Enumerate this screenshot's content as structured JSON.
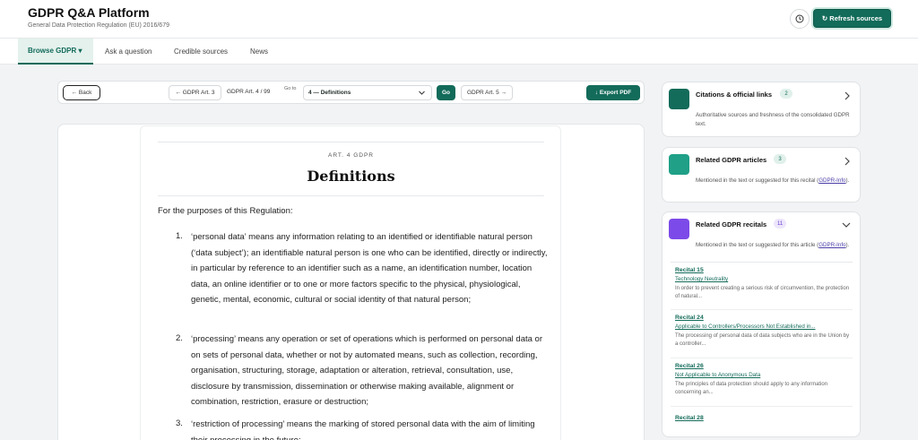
{
  "app": {
    "title": "GDPR Q&A Platform",
    "subtitle": "General Data Protection Regulation (EU) 2016/679",
    "refresh_label": "↻ Refresh sources"
  },
  "tabs": [
    {
      "label": "Browse GDPR ▾",
      "active": true
    },
    {
      "label": "Ask a question"
    },
    {
      "label": "Credible sources"
    },
    {
      "label": "News"
    }
  ],
  "toolbar": {
    "back_label": "← Back",
    "prev_label": "← GDPR Art. 3",
    "position_label": "GDPR Art. 4 / 99",
    "goto_label": "Go to",
    "select_value": "4 — Definitions",
    "go_label": "Go",
    "next_label": "GDPR Art. 5 →",
    "export_label": "↓ Export PDF"
  },
  "document": {
    "kicker": "ART. 4 GDPR",
    "title": "Definitions",
    "intro": "For the purposes of this Regulation:",
    "definitions": [
      {
        "num": "1.",
        "text": "‘personal data’ means any information relating to an identified or identifiable natural person (‘data subject’); an identifiable natural person is one who can be identified, directly or indirectly, in particular by reference to an identifier such as a name, an identification number, location data, an online identifier or to one or more factors specific to the physical, physiological, genetic, mental, economic, cultural or social identity of that natural person;"
      },
      {
        "num": "2.",
        "text": "‘processing’ means any operation or set of operations which is performed on personal data or on sets of personal data, whether or not by automated means, such as collection, recording, organisation, structuring, storage, adaptation or alteration, retrieval, consultation, use, disclosure by transmission, dissemination or otherwise making available, alignment or combination, restriction, erasure or destruction;"
      },
      {
        "num": "3.",
        "text": "‘restriction of processing’ means the marking of stored personal data with the aim of limiting their processing in the future;"
      }
    ]
  },
  "sidebar": {
    "citations": {
      "title": "Citations & official links",
      "badge": "2",
      "desc": "Authoritative sources and freshness of the consolidated GDPR text.",
      "color": "#136b5a",
      "badge_bg": "#e0f0ea",
      "badge_fg": "#136b5a"
    },
    "articles": {
      "title": "Related GDPR articles",
      "badge": "3",
      "desc_before": "Mentioned in the text or suggested for this recital (",
      "desc_link": "GDPR-Info",
      "desc_after": ").",
      "color": "#1fa087",
      "badge_bg": "#e0f0ea",
      "badge_fg": "#136b5a"
    },
    "recitals": {
      "title": "Related GDPR recitals",
      "badge": "11",
      "desc_before": "Mentioned in the text or suggested for this article (",
      "desc_link": "GDPR-Info",
      "desc_after": ").",
      "color": "#7c4ae8",
      "badge_bg": "#ede6fb",
      "badge_fg": "#6a3fd1",
      "items": [
        {
          "title": "Recital 15",
          "subtitle": "Technology Neutrality",
          "text": "In order to prevent creating a serious risk of circumvention, the protection of natural..."
        },
        {
          "title": "Recital 24",
          "subtitle": "Applicable to Controllers/Processors Not Established in...",
          "text": "The processing of personal data of data subjects who are in the Union by a controller..."
        },
        {
          "title": "Recital 26",
          "subtitle": "Not Applicable to Anonymous Data",
          "text": "The principles of data protection should apply to any information concerning an..."
        },
        {
          "title": "Recital 28",
          "subtitle": "",
          "text": ""
        }
      ]
    }
  }
}
